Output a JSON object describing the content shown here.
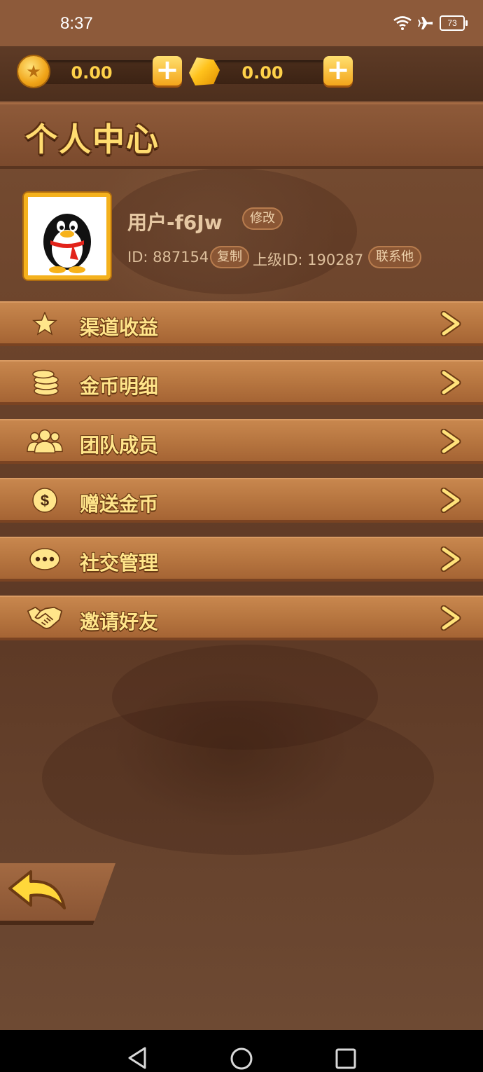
{
  "status_bar": {
    "time": "8:37",
    "battery": "73"
  },
  "currency": {
    "gold": "0.00",
    "gem": "0.00"
  },
  "title": "个人中心",
  "profile": {
    "username": "用户-f6Jw",
    "edit_label": "修改",
    "id_text": "ID: 887154",
    "copy_label": "复制",
    "parent_id_text": "上级ID: 190287",
    "contact_label": "联系他"
  },
  "menu": [
    {
      "label": "渠道收益",
      "icon": "star-icon"
    },
    {
      "label": "金币明细",
      "icon": "coins-icon"
    },
    {
      "label": "团队成员",
      "icon": "team-icon"
    },
    {
      "label": "赠送金币",
      "icon": "dollar-icon"
    },
    {
      "label": "社交管理",
      "icon": "chat-icon"
    },
    {
      "label": "邀请好友",
      "icon": "handshake-icon"
    }
  ],
  "colors": {
    "accent": "#ffe58a",
    "menu_bg": "#b77640",
    "background": "#6b432b"
  }
}
